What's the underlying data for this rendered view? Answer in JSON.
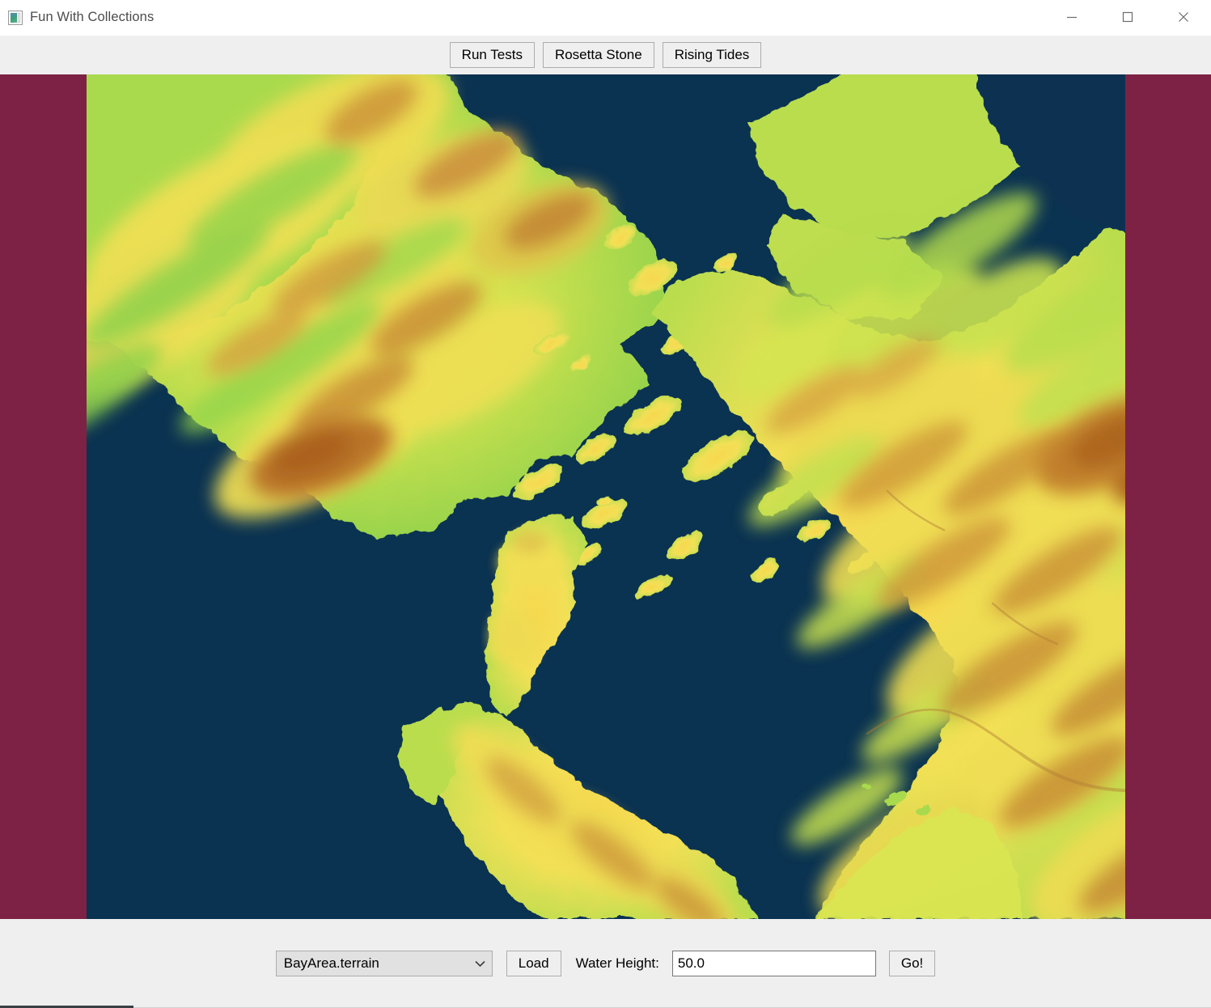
{
  "window": {
    "title": "Fun With Collections",
    "icon": "app-window-image-icon",
    "controls": {
      "minimize": "minimize-icon",
      "maximize": "maximize-icon",
      "close": "close-icon"
    }
  },
  "top_toolbar": {
    "buttons": [
      {
        "label": "Run Tests",
        "name": "run-tests-button"
      },
      {
        "label": "Rosetta Stone",
        "name": "rosetta-stone-button"
      },
      {
        "label": "Rising Tides",
        "name": "rising-tides-button"
      }
    ]
  },
  "bottom_toolbar": {
    "terrain_select": {
      "value": "BayArea.terrain",
      "options": [
        "BayArea.terrain"
      ],
      "chevron": "chevron-down-icon"
    },
    "load_label": "Load",
    "water_height_label": "Water Height:",
    "water_height_value": "50.0",
    "water_height_placeholder": "",
    "go_label": "Go!"
  },
  "terrain_view": {
    "background_color": "#7d2244",
    "ocean_color": "#0a3251",
    "colormap": {
      "low_land": "#7fd04a",
      "mid_land": "#c8e24f",
      "high_land": "#ffe14d",
      "hill": "#e0a94a",
      "peak": "#b4682a"
    },
    "map_name": "BayArea.terrain",
    "water_level": "50.0"
  },
  "status_bar": {
    "scroll_thumb_width": "165"
  }
}
